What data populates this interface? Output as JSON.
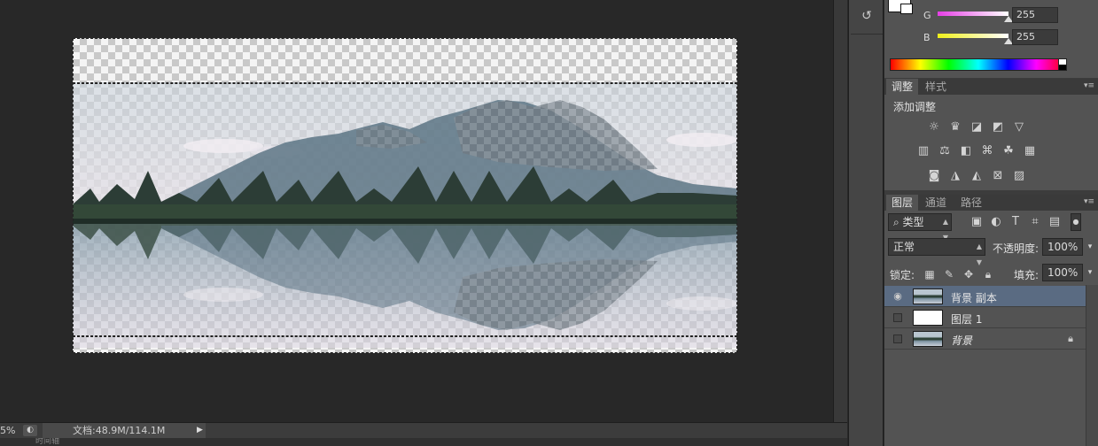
{
  "statusbar": {
    "zoom": "5%",
    "doc_info": "文档:48.9M/114.1M",
    "bottom_tabs": "时间轴"
  },
  "color_panel": {
    "channels": [
      {
        "label": "G",
        "value": "255",
        "slider_color": "#e63ee6",
        "level": 1.0
      },
      {
        "label": "B",
        "value": "255",
        "slider_color": "#f0f01a",
        "level": 1.0
      }
    ]
  },
  "adjustments_panel": {
    "tabs": [
      "调整",
      "样式"
    ],
    "title": "添加调整",
    "icons": [
      [
        "brightness-contrast-icon",
        "levels-icon",
        "curves-icon",
        "exposure-icon",
        "gradient-triangle-icon"
      ],
      [
        "vibrance-icon",
        "balance-icon",
        "black-white-icon",
        "photo-filter-icon",
        "channel-mixer-icon",
        "color-lookup-icon"
      ],
      [
        "invert-icon",
        "posterize-icon",
        "threshold-icon",
        "selective-color-icon",
        "gradient-map-icon"
      ]
    ]
  },
  "layers_panel": {
    "tabs": [
      "图层",
      "通道",
      "路径"
    ],
    "filter_kind": "类型",
    "blend_mode": "正常",
    "opacity_label": "不透明度:",
    "opacity_value": "100%",
    "lock_label": "锁定:",
    "fill_label": "填充:",
    "fill_value": "100%",
    "layers": [
      {
        "name": "背景 副本",
        "visible": true,
        "selected": true,
        "thumb": "landscape",
        "locked": false
      },
      {
        "name": "图层 1",
        "visible": false,
        "selected": false,
        "thumb": "white",
        "locked": false
      },
      {
        "name": "背景",
        "visible": false,
        "selected": false,
        "thumb": "landscape",
        "locked": true
      }
    ]
  }
}
